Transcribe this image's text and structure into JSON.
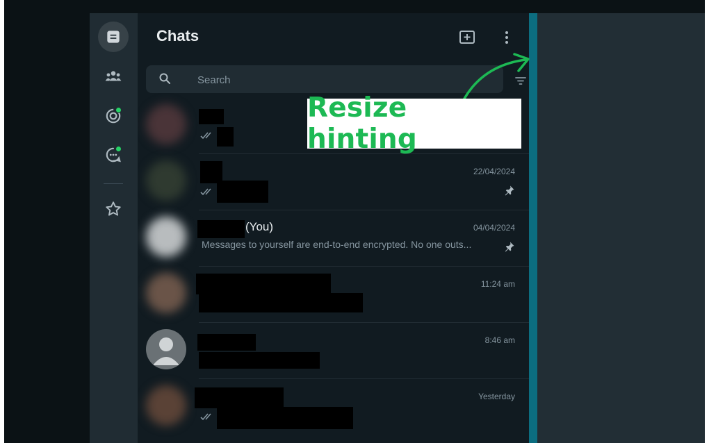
{
  "panel": {
    "title": "Chats",
    "search_placeholder": "Search"
  },
  "chats": [
    {
      "time": "",
      "name_suffix": "",
      "preview": "",
      "pinned": false,
      "ticks": true
    },
    {
      "time": "22/04/2024",
      "name_suffix": "",
      "preview": "",
      "pinned": true,
      "ticks": true
    },
    {
      "time": "04/04/2024",
      "name_suffix": "(You)",
      "preview": "Messages to yourself are end-to-end encrypted. No one outs...",
      "pinned": true,
      "ticks": false
    },
    {
      "time": "11:24 am",
      "name_suffix": "",
      "preview": "",
      "pinned": false,
      "ticks": false
    },
    {
      "time": "8:46 am",
      "name_suffix": "",
      "preview": "",
      "pinned": false,
      "ticks": false
    },
    {
      "time": "Yesterday",
      "name_suffix": "",
      "preview": "",
      "pinned": false,
      "ticks": true
    }
  ],
  "annotation": {
    "text": "Resize hinting",
    "color": "#1db954"
  },
  "colors": {
    "accent_teal": "#0c6d80",
    "panel_bg": "#111b21",
    "rail_bg": "#202c33",
    "status_dot": "#25d366"
  },
  "icons": {
    "rail": [
      "chats-icon",
      "communities-icon",
      "status-icon",
      "channels-icon",
      "starred-icon"
    ],
    "header": [
      "new-chat-icon",
      "menu-icon"
    ],
    "search": "search-icon",
    "filter": "filter-icon"
  }
}
